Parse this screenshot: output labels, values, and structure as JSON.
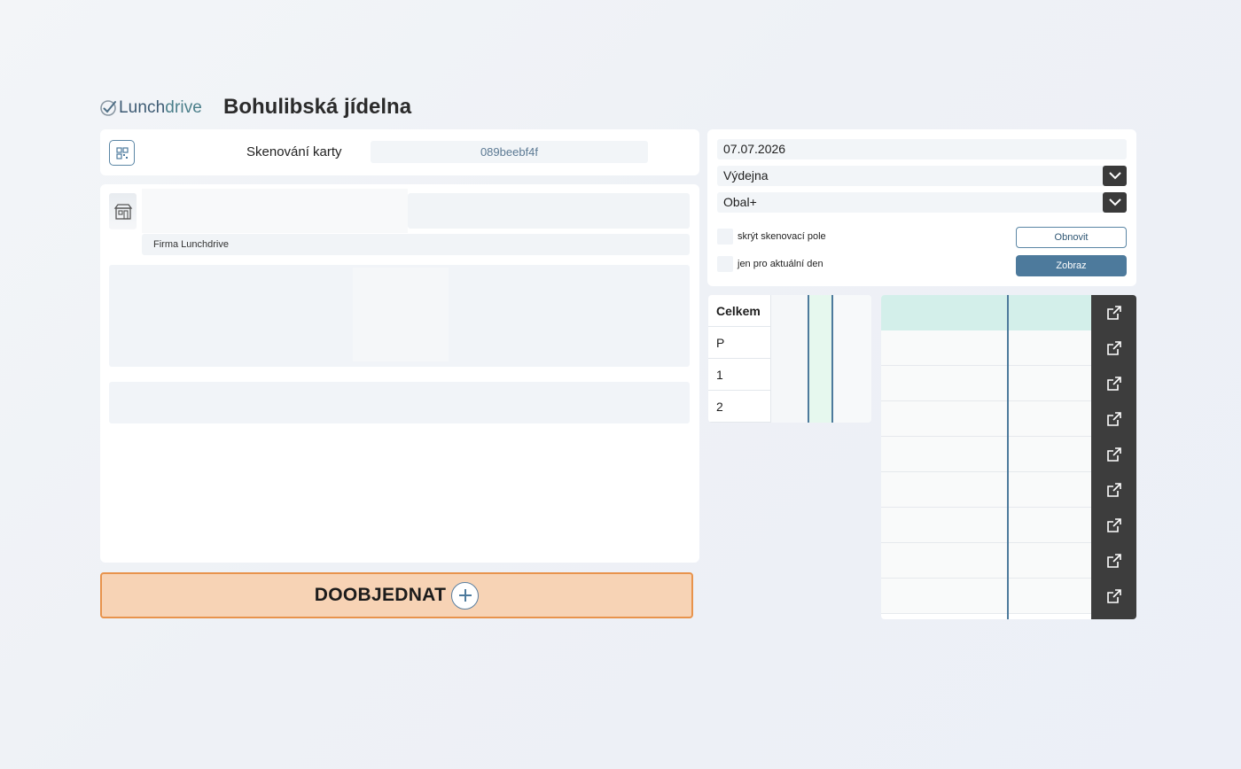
{
  "header": {
    "logo_text_a": "Lunch",
    "logo_text_b": "drive",
    "title": "Bohulibská jídelna"
  },
  "scan": {
    "label": "Skenování karty",
    "card_value": "089beebf4f"
  },
  "detail": {
    "company": "Firma Lunchdrive"
  },
  "order_button": {
    "label": "DOOBJEDNAT"
  },
  "filters": {
    "date": "07.07.2026",
    "outlet": "Výdejna",
    "package": "Obal+",
    "hide_scan_label": "skrýt skenovací pole",
    "today_only_label": "jen pro aktuální den",
    "refresh_label": "Obnovit",
    "show_label": "Zobraz"
  },
  "summary": {
    "rows": [
      "Celkem",
      "P",
      "1",
      "2"
    ]
  },
  "colors": {
    "accent": "#4d7a9c",
    "order_bg": "#f7d3b5",
    "order_border": "#e8934c",
    "header_mint": "#d3efea",
    "action_col": "#3d3d3d"
  },
  "icons": {
    "qr": "qr-code-icon",
    "store": "store-icon",
    "plus": "plus-icon",
    "chevron": "chevron-down-icon",
    "open": "external-link-icon"
  }
}
